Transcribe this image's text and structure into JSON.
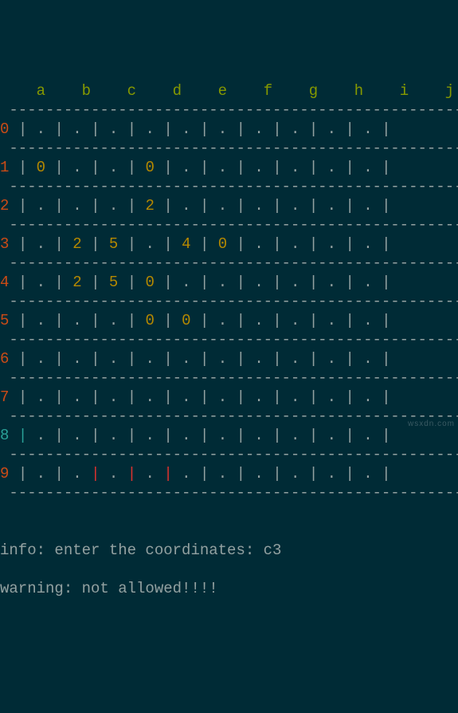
{
  "grid": {
    "columns": [
      "a",
      "b",
      "c",
      "d",
      "e",
      "f",
      "g",
      "h",
      "i",
      "j"
    ],
    "row_labels": [
      "0",
      "1",
      "2",
      "3",
      "4",
      "5",
      "6",
      "7",
      "8",
      "9"
    ],
    "cells": [
      [
        ".",
        ".",
        ".",
        ".",
        ".",
        ".",
        ".",
        ".",
        ".",
        "."
      ],
      [
        "0",
        ".",
        ".",
        "0",
        ".",
        ".",
        ".",
        ".",
        ".",
        "."
      ],
      [
        ".",
        ".",
        ".",
        "2",
        ".",
        ".",
        ".",
        ".",
        ".",
        "."
      ],
      [
        ".",
        "2",
        "5",
        ".",
        "4",
        "0",
        ".",
        ".",
        ".",
        "."
      ],
      [
        ".",
        "2",
        "5",
        "0",
        ".",
        ".",
        ".",
        ".",
        ".",
        "."
      ],
      [
        ".",
        ".",
        ".",
        "0",
        "0",
        ".",
        ".",
        ".",
        ".",
        "."
      ],
      [
        ".",
        ".",
        ".",
        ".",
        ".",
        ".",
        ".",
        ".",
        ".",
        "."
      ],
      [
        ".",
        ".",
        ".",
        ".",
        ".",
        ".",
        ".",
        ".",
        ".",
        "."
      ],
      [
        ".",
        ".",
        ".",
        ".",
        ".",
        ".",
        ".",
        ".",
        ".",
        "."
      ],
      [
        ".",
        ".",
        ".",
        ".",
        ".",
        ".",
        ".",
        ".",
        ".",
        "."
      ]
    ],
    "cursor_row": 8,
    "hit_row": 9,
    "hit_cols": [
      2,
      3,
      4
    ]
  },
  "messages": {
    "info_label": "info:",
    "info_text": " enter the coordinates: c3",
    "warn_label": "warning:",
    "warn_text": " not allowed!!!!"
  },
  "watermark": "wsxdn.com"
}
